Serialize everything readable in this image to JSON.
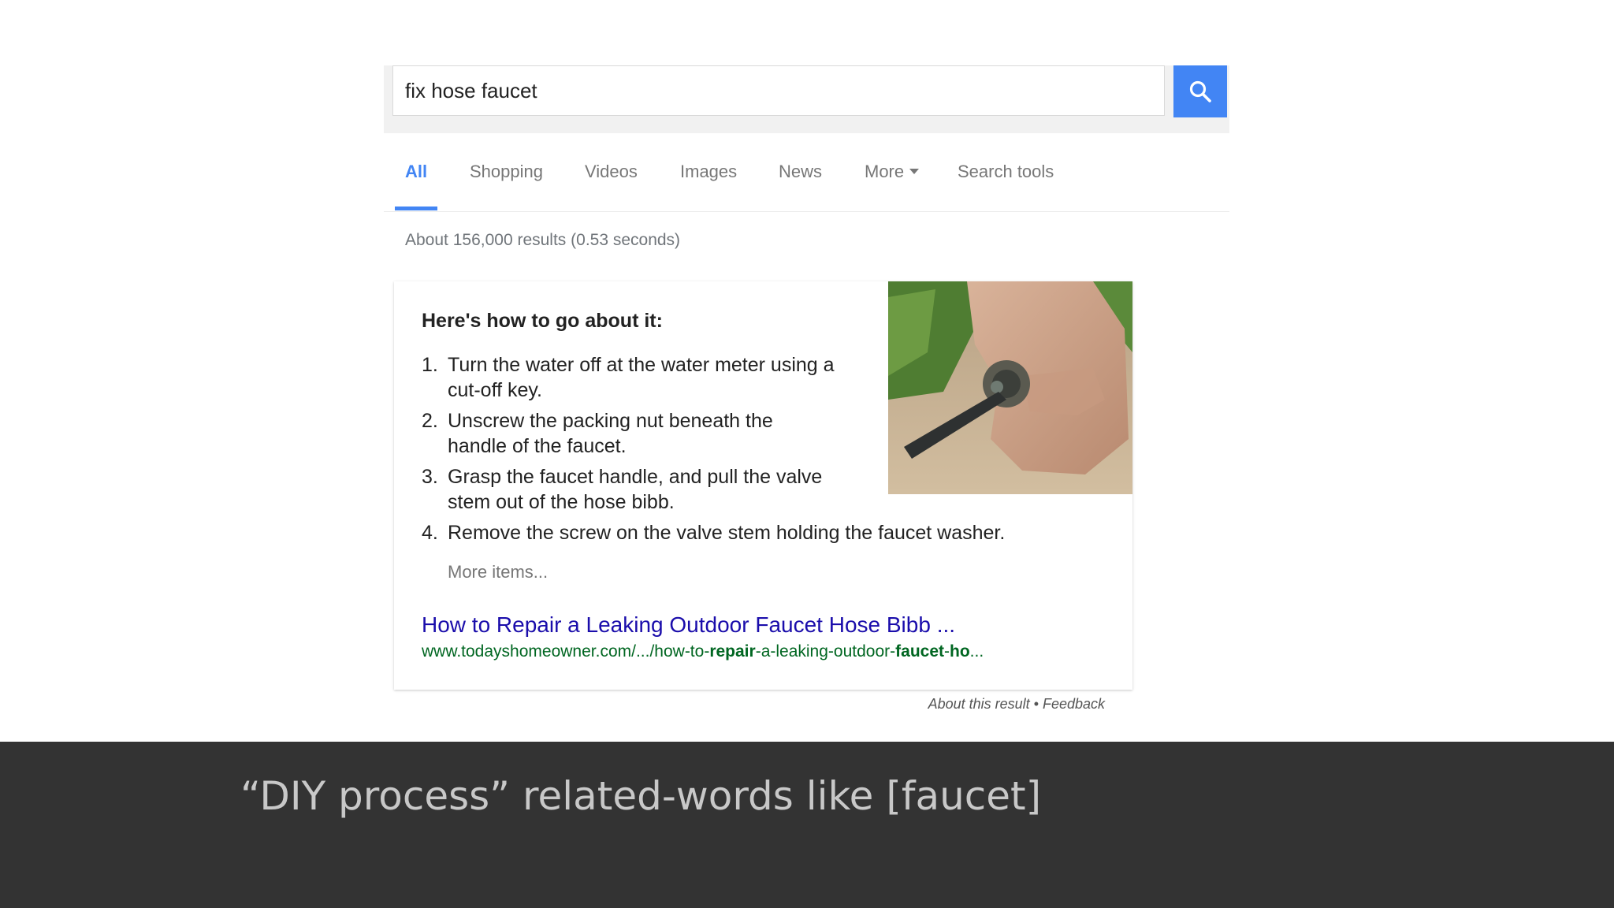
{
  "search": {
    "query": "fix hose faucet"
  },
  "tabs": [
    {
      "label": "All",
      "active": true
    },
    {
      "label": "Shopping"
    },
    {
      "label": "Videos"
    },
    {
      "label": "Images"
    },
    {
      "label": "News"
    },
    {
      "label": "More"
    },
    {
      "label": "Search tools"
    }
  ],
  "results_count": "About 156,000 results (0.53 seconds)",
  "snippet": {
    "heading": "Here's how to go about it:",
    "steps": [
      {
        "num": "1.",
        "text": "Turn the water off at the water meter using a cut-off key."
      },
      {
        "num": "2.",
        "text": "Unscrew the packing nut beneath the handle of the faucet."
      },
      {
        "num": "3.",
        "text": "Grasp the faucet handle, and pull the valve stem out of the hose bibb."
      },
      {
        "num": "4.",
        "text": "Remove the screw on the valve stem holding the faucet washer."
      }
    ],
    "more_items": "More items...",
    "result_title": "How to Repair a Leaking Outdoor Faucet Hose Bibb ...",
    "result_url": {
      "p1": "www.todayshomeowner.com/.../how-to-",
      "b1": "repair",
      "p2": "-a-leaking-outdoor-",
      "b2": "faucet",
      "p3": "-",
      "b3": "ho",
      "p4": "..."
    },
    "about": "About this result • Feedback"
  },
  "caption": "“DIY process” related-words like [faucet]",
  "colors": {
    "accent": "#4285f4",
    "link": "#1a0dab",
    "url": "#006621",
    "band": "#333333"
  }
}
